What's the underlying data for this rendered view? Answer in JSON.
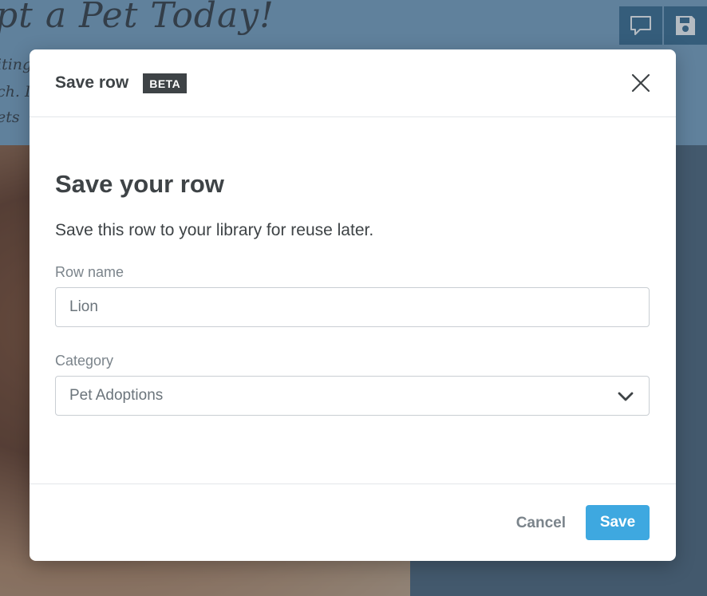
{
  "background": {
    "page_title": "pt a Pet Today!",
    "text_lines": [
      "iting",
      "ch. I",
      "ets"
    ]
  },
  "toolbar": {
    "comment_icon": "comment-icon",
    "save_icon": "save-icon"
  },
  "modal": {
    "title": "Save row",
    "badge": "BETA",
    "heading": "Save your row",
    "description": "Save this row to your library for reuse later.",
    "row_name": {
      "label": "Row name",
      "value": "Lion"
    },
    "category": {
      "label": "Category",
      "value": "Pet Adoptions"
    },
    "cancel_label": "Cancel",
    "save_label": "Save"
  },
  "colors": {
    "accent": "#3ea8e0",
    "text_dark": "#3e4346",
    "text_muted": "#7b848b"
  }
}
